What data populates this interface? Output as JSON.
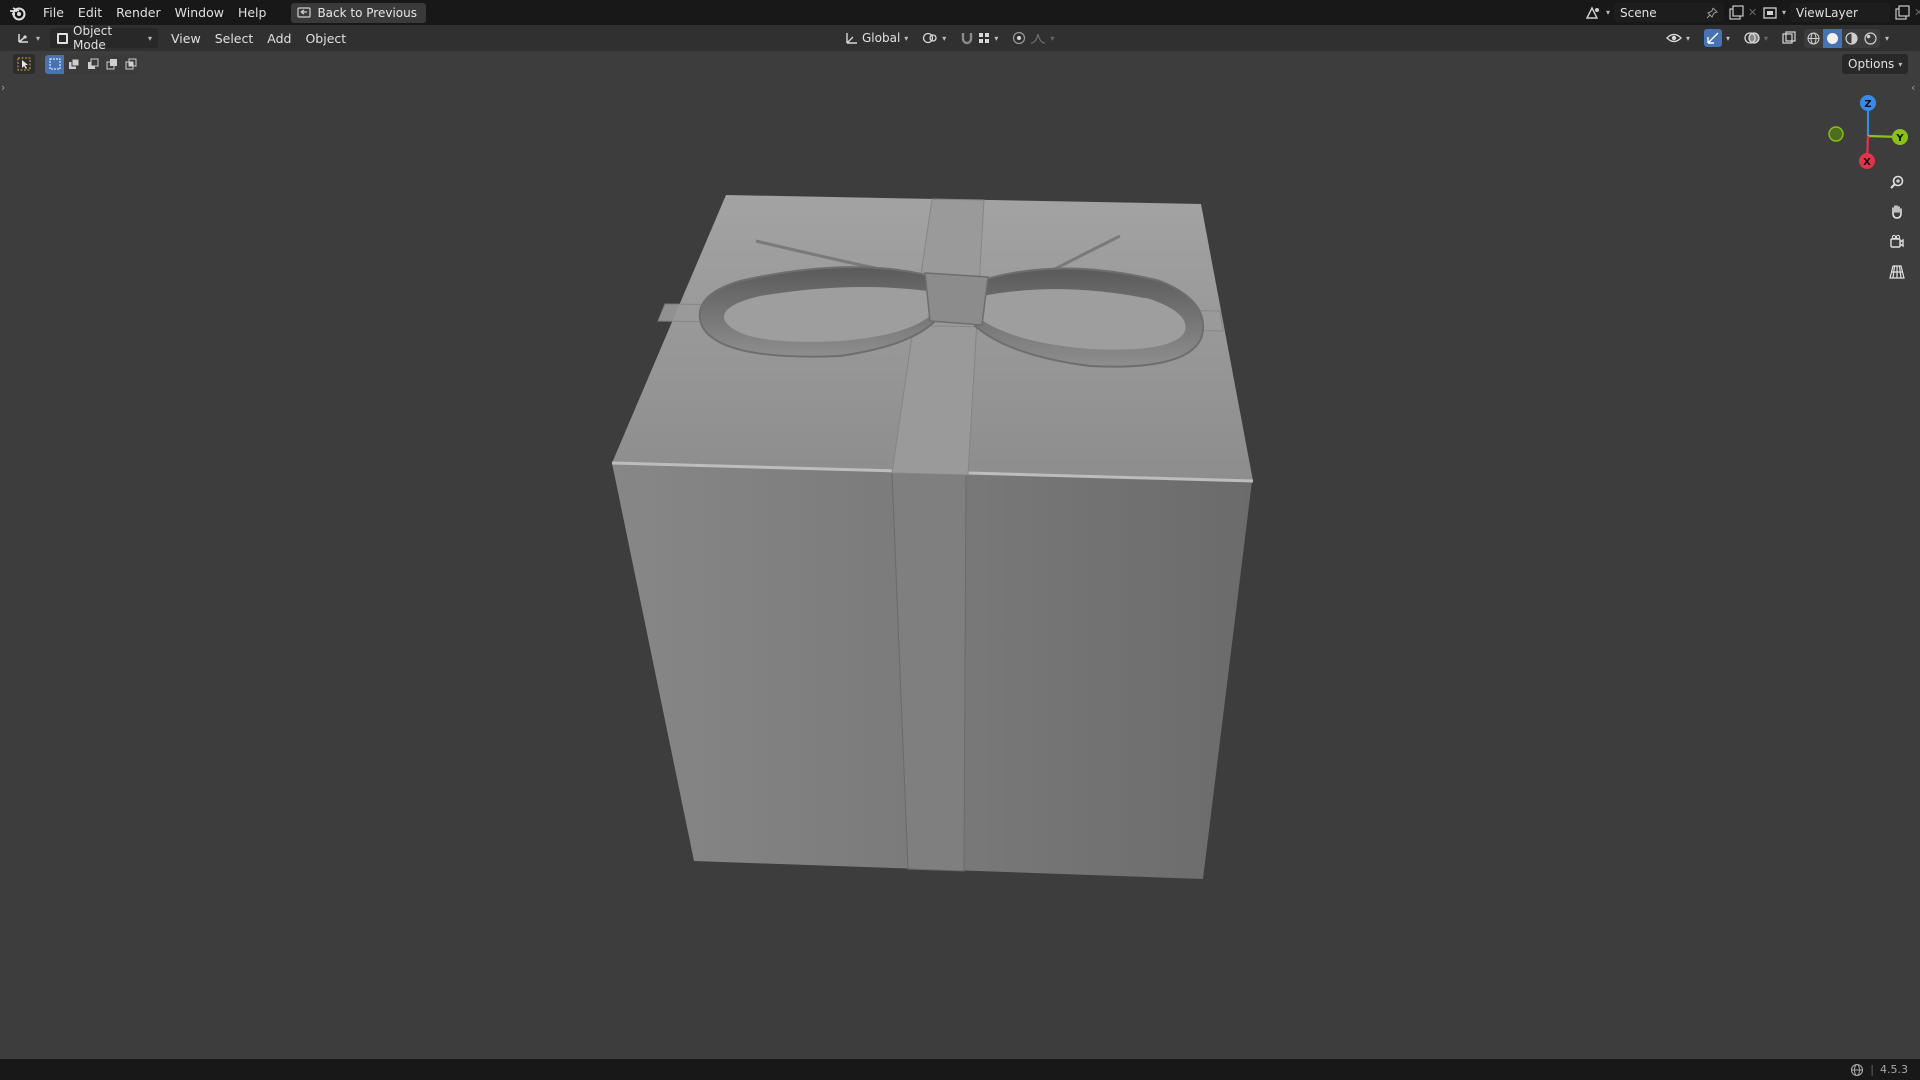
{
  "menu": {
    "items": [
      "File",
      "Edit",
      "Render",
      "Window",
      "Help"
    ],
    "back_button": "Back to Previous"
  },
  "scene": {
    "label": "Scene"
  },
  "view_layer": {
    "label": "ViewLayer"
  },
  "header": {
    "mode": "Object Mode",
    "menus": [
      "View",
      "Select",
      "Add",
      "Object"
    ],
    "transform_orientation": "Global",
    "options": "Options"
  },
  "gizmo": {
    "z": "Z",
    "y": "Y",
    "x": "X"
  },
  "status": {
    "version": "4.5.3"
  },
  "colors": {
    "accent": "#4772b3",
    "axis_x": "#e2334b",
    "axis_y": "#8bc21a",
    "axis_z": "#3a8be6"
  }
}
